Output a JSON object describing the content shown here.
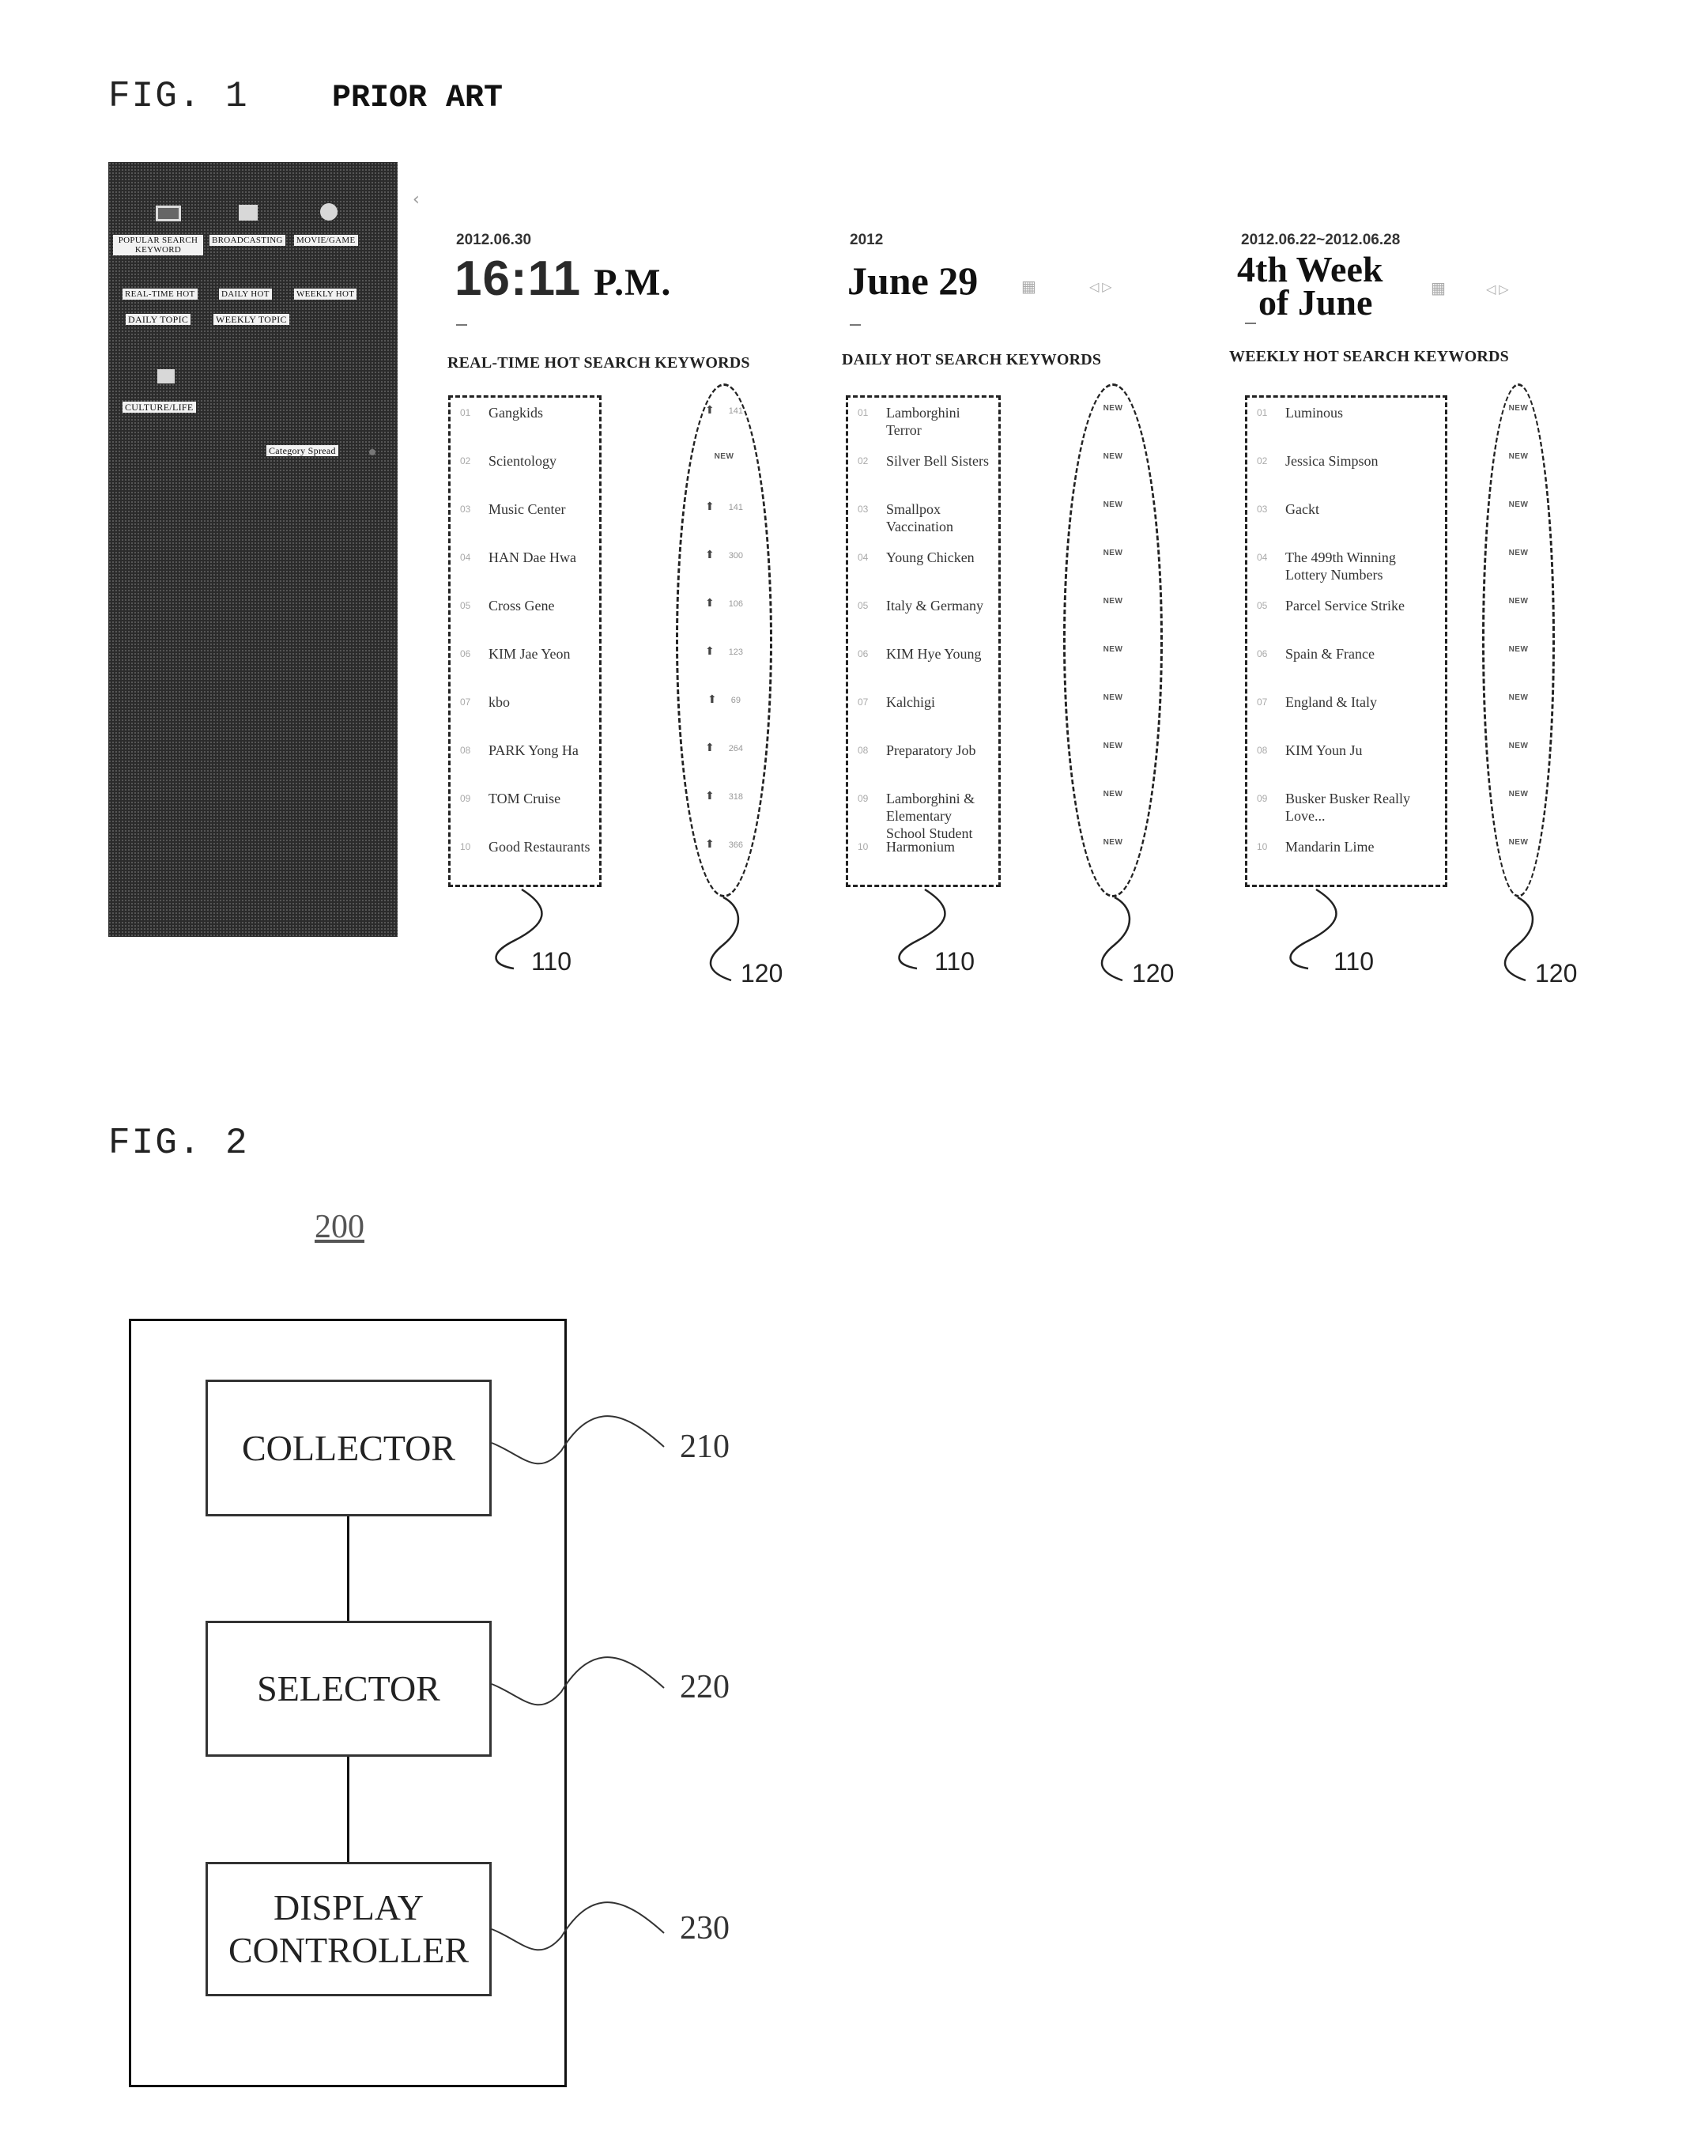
{
  "fig1": {
    "label": "FIG. 1",
    "subtitle": "PRIOR ART",
    "sidebar": {
      "categories": [
        {
          "label": "POPULAR SEARCH KEYWORD",
          "icon": "tv-icon"
        },
        {
          "label": "BROADCASTING",
          "icon": "broadcast-icon"
        },
        {
          "label": "MOVIE/GAME",
          "icon": "film-reel-icon"
        }
      ],
      "tabs": [
        "REAL-TIME HOT",
        "DAILY HOT",
        "WEEKLY HOT",
        "DAILY TOPIC",
        "WEEKLY TOPIC"
      ],
      "culture": {
        "label": "CULTURE/LIFE",
        "icon": "book-icon"
      },
      "spread_button": "Category Spread",
      "collapse_glyph": "‹"
    },
    "panels": [
      {
        "id": "realtime",
        "date": "2012.06.30",
        "title_main": "16:11",
        "title_suffix": "P.M.",
        "heading": "REAL-TIME HOT SEARCH KEYWORDS",
        "keywords": [
          {
            "rank": "01",
            "text": "Gangkids",
            "change": "141",
            "type": "up"
          },
          {
            "rank": "02",
            "text": "Scientology",
            "change": "NEW",
            "type": "new"
          },
          {
            "rank": "03",
            "text": "Music Center",
            "change": "141",
            "type": "up"
          },
          {
            "rank": "04",
            "text": "HAN Dae Hwa",
            "change": "300",
            "type": "up"
          },
          {
            "rank": "05",
            "text": "Cross Gene",
            "change": "106",
            "type": "up"
          },
          {
            "rank": "06",
            "text": "KIM Jae Yeon",
            "change": "123",
            "type": "up"
          },
          {
            "rank": "07",
            "text": "kbo",
            "change": "69",
            "type": "up"
          },
          {
            "rank": "08",
            "text": "PARK Yong Ha",
            "change": "264",
            "type": "up"
          },
          {
            "rank": "09",
            "text": "TOM Cruise",
            "change": "318",
            "type": "up"
          },
          {
            "rank": "10",
            "text": "Good Restaurants",
            "change": "366",
            "type": "up"
          }
        ],
        "ref_list": "110",
        "ref_change": "120"
      },
      {
        "id": "daily",
        "date": "2012",
        "title_main": "June 29",
        "heading": "DAILY HOT SEARCH KEYWORDS",
        "keywords": [
          {
            "rank": "01",
            "text": "Lamborghini Terror",
            "change": "NEW",
            "type": "new"
          },
          {
            "rank": "02",
            "text": "Silver Bell Sisters",
            "change": "NEW",
            "type": "new"
          },
          {
            "rank": "03",
            "text": "Smallpox Vaccination",
            "change": "NEW",
            "type": "new"
          },
          {
            "rank": "04",
            "text": "Young Chicken",
            "change": "NEW",
            "type": "new"
          },
          {
            "rank": "05",
            "text": "Italy & Germany",
            "change": "NEW",
            "type": "new"
          },
          {
            "rank": "06",
            "text": "KIM Hye Young",
            "change": "NEW",
            "type": "new"
          },
          {
            "rank": "07",
            "text": "Kalchigi",
            "change": "NEW",
            "type": "new"
          },
          {
            "rank": "08",
            "text": "Preparatory Job",
            "change": "NEW",
            "type": "new"
          },
          {
            "rank": "09",
            "text": "Lamborghini & Elementary School Student",
            "change": "NEW",
            "type": "new"
          },
          {
            "rank": "10",
            "text": "Harmonium",
            "change": "NEW",
            "type": "new"
          }
        ],
        "ref_list": "110",
        "ref_change": "120"
      },
      {
        "id": "weekly",
        "date": "2012.06.22~2012.06.28",
        "title_main": "4th Week",
        "title_line2": "of June",
        "heading": "WEEKLY HOT SEARCH KEYWORDS",
        "keywords": [
          {
            "rank": "01",
            "text": "Luminous",
            "change": "NEW",
            "type": "new"
          },
          {
            "rank": "02",
            "text": "Jessica Simpson",
            "change": "NEW",
            "type": "new"
          },
          {
            "rank": "03",
            "text": "Gackt",
            "change": "NEW",
            "type": "new"
          },
          {
            "rank": "04",
            "text": "The 499th Winning Lottery Numbers",
            "change": "NEW",
            "type": "new"
          },
          {
            "rank": "05",
            "text": "Parcel Service Strike",
            "change": "NEW",
            "type": "new"
          },
          {
            "rank": "06",
            "text": "Spain & France",
            "change": "NEW",
            "type": "new"
          },
          {
            "rank": "07",
            "text": "England & Italy",
            "change": "NEW",
            "type": "new"
          },
          {
            "rank": "08",
            "text": "KIM Youn Ju",
            "change": "NEW",
            "type": "new"
          },
          {
            "rank": "09",
            "text": "Busker Busker Really Love...",
            "change": "NEW",
            "type": "new"
          },
          {
            "rank": "10",
            "text": "Mandarin Lime",
            "change": "NEW",
            "type": "new"
          }
        ],
        "ref_list": "110",
        "ref_change": "120"
      }
    ],
    "icons": {
      "calendar": "calendar-icon",
      "nav": "prev-next-icon",
      "up_arrow": "⬆"
    }
  },
  "fig2": {
    "label": "FIG. 2",
    "system_ref": "200",
    "blocks": [
      {
        "label": "COLLECTOR",
        "ref": "210"
      },
      {
        "label": "SELECTOR",
        "ref": "220"
      },
      {
        "label": "DISPLAY CONTROLLER",
        "ref": "230"
      }
    ]
  }
}
